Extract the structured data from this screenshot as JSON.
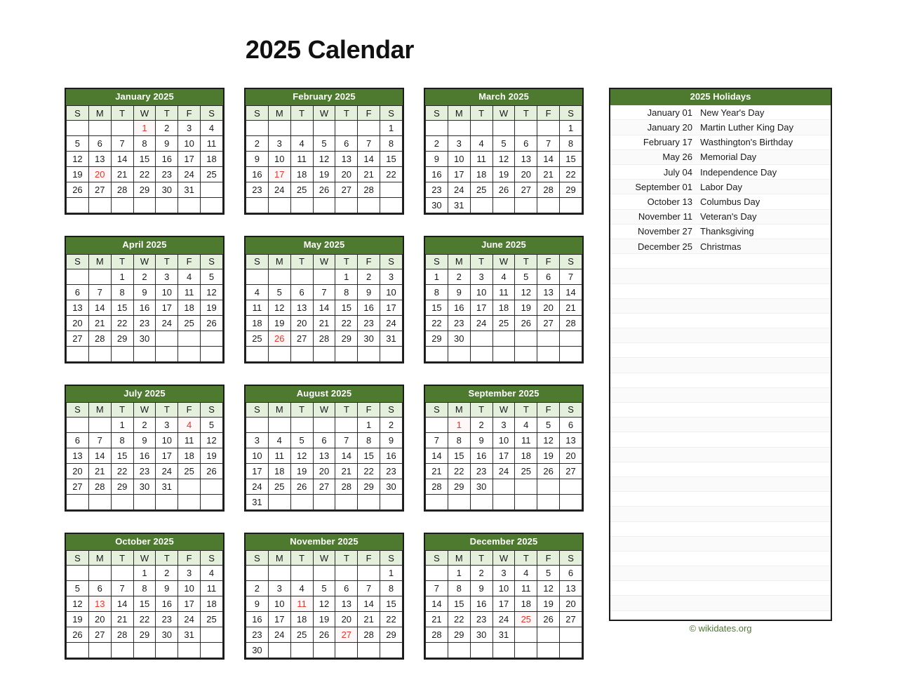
{
  "page": {
    "title": "2025 Calendar",
    "footer": "© wikidates.org",
    "accent_green": "#4d7a2f",
    "weekday_header_bg": "#e4efdc",
    "holiday_red": "#e8352a"
  },
  "weekday_labels": [
    "S",
    "M",
    "T",
    "W",
    "T",
    "F",
    "S"
  ],
  "months": [
    {
      "name": "January 2025",
      "first_weekday": 3,
      "days_in_month": 31,
      "rows": 6,
      "holidays": [
        1,
        20
      ]
    },
    {
      "name": "February 2025",
      "first_weekday": 6,
      "days_in_month": 28,
      "rows": 6,
      "holidays": [
        17
      ]
    },
    {
      "name": "March 2025",
      "first_weekday": 6,
      "days_in_month": 31,
      "rows": 6,
      "holidays": []
    },
    {
      "name": "April 2025",
      "first_weekday": 2,
      "days_in_month": 30,
      "rows": 6,
      "holidays": []
    },
    {
      "name": "May 2025",
      "first_weekday": 4,
      "days_in_month": 31,
      "rows": 6,
      "holidays": [
        26
      ]
    },
    {
      "name": "June 2025",
      "first_weekday": 0,
      "days_in_month": 30,
      "rows": 6,
      "holidays": []
    },
    {
      "name": "July 2025",
      "first_weekday": 2,
      "days_in_month": 31,
      "rows": 6,
      "holidays": [
        4
      ]
    },
    {
      "name": "August 2025",
      "first_weekday": 5,
      "days_in_month": 31,
      "rows": 6,
      "holidays": []
    },
    {
      "name": "September 2025",
      "first_weekday": 1,
      "days_in_month": 30,
      "rows": 6,
      "holidays": [
        1
      ]
    },
    {
      "name": "October 2025",
      "first_weekday": 3,
      "days_in_month": 31,
      "rows": 6,
      "holidays": [
        13
      ]
    },
    {
      "name": "November 2025",
      "first_weekday": 6,
      "days_in_month": 30,
      "rows": 6,
      "holidays": [
        11,
        27
      ]
    },
    {
      "name": "December 2025",
      "first_weekday": 1,
      "days_in_month": 31,
      "rows": 6,
      "holidays": [
        25
      ]
    }
  ],
  "holidays_panel": {
    "title": "2025 Holidays",
    "total_rows": 34,
    "items": [
      {
        "date": "January 01",
        "name": "New Year's Day"
      },
      {
        "date": "January 20",
        "name": "Martin Luther King Day"
      },
      {
        "date": "February 17",
        "name": "Wasthington's Birthday"
      },
      {
        "date": "May 26",
        "name": "Memorial Day"
      },
      {
        "date": "July 04",
        "name": "Independence Day"
      },
      {
        "date": "September 01",
        "name": "Labor Day"
      },
      {
        "date": "October 13",
        "name": "Columbus Day"
      },
      {
        "date": "November 11",
        "name": "Veteran's Day"
      },
      {
        "date": "November 27",
        "name": "Thanksgiving"
      },
      {
        "date": "December 25",
        "name": "Christmas"
      }
    ]
  }
}
